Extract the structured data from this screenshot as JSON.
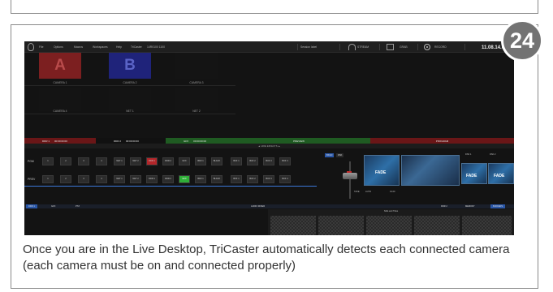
{
  "step_number": "24",
  "caption": "Once you are in the Live Desktop, TriCaster automatically detects each connected camera (each camera must be on and connected properly)",
  "menubar": {
    "items": [
      "File",
      "Options",
      "Macros",
      "Workspaces",
      "Help",
      "TriCaster",
      "14R0100 1100"
    ],
    "session": "Session label",
    "streaming": "STREAM",
    "grab": "GRAB",
    "record": "RECORD",
    "clock": "11.08.14.02"
  },
  "monitors": {
    "top": [
      {
        "label": "CAMERA 1",
        "letter": "A"
      },
      {
        "label": "CAMERA 2",
        "letter": "B"
      },
      {
        "label": "CAMERA 3",
        "letter": ""
      }
    ],
    "bottom": [
      {
        "label": "CAMERA 4"
      },
      {
        "label": "NET 1"
      },
      {
        "label": "NET 2"
      }
    ]
  },
  "buses": {
    "ddr1": "DDR 1",
    "ddr1_time": "00:00:00:00",
    "ddr2": "DDR 2",
    "ddr2_time": "00:00:00:00",
    "gfx": "GFX",
    "gfx_time": "00:00:00:00",
    "preview": "PREVIEW",
    "program": "PROGRAM",
    "record_bar": "▲ HIDE EFFECTS ▲"
  },
  "switcher": {
    "program_label": "PGM",
    "preview_label": "PREV",
    "program_buttons": [
      "1",
      "2",
      "3",
      "4",
      "NET 1",
      "NET 2",
      "DDR 1",
      "DDR 2",
      "GFX",
      "BFR 1",
      "BLACK",
      "BUF 1",
      "BUF 2",
      "BUF 3",
      "BUF 4"
    ],
    "preview_buttons": [
      "1",
      "2",
      "3",
      "4",
      "NET 1",
      "NET 2",
      "DDR 1",
      "DDR 2",
      "GFX",
      "BFR 1",
      "BLACK",
      "BUF 1",
      "BUF 2",
      "BUF 3",
      "BUF 4"
    ]
  },
  "transition": {
    "tabs": [
      "BKGD",
      "DSK"
    ],
    "fade": "FADE",
    "fade2": "FADE",
    "fade3": "FADE",
    "auto": "AUTO",
    "take": "TAKE",
    "time": "01.00",
    "dsk1": "DSK 1",
    "dsk2": "DSK 2"
  },
  "bottom_tabs": {
    "left": [
      "DDR 1",
      "GFX",
      "PTZ"
    ],
    "center": "AUDIO MIXER",
    "right": [
      "DDR 2",
      "MEMORY",
      "BUFFERS"
    ]
  },
  "media": {
    "header": "Stills and Titles"
  }
}
